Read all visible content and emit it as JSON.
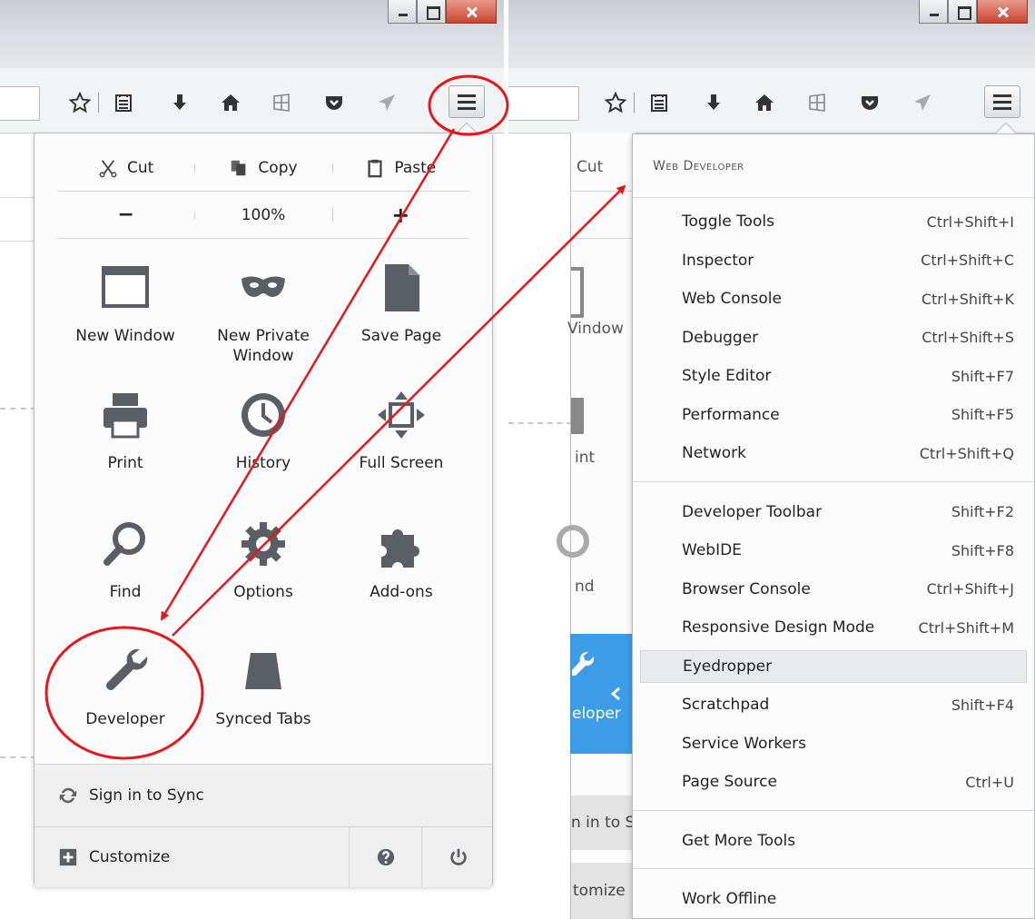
{
  "left_panel": {
    "edit": {
      "cut": "Cut",
      "copy": "Copy",
      "paste": "Paste"
    },
    "zoom": {
      "minus": "−",
      "level": "100%",
      "plus": "+"
    },
    "items": [
      {
        "label": "New Window",
        "icon": "window-icon"
      },
      {
        "label": "New Private\nWindow",
        "icon": "mask-icon"
      },
      {
        "label": "Save Page",
        "icon": "page-icon"
      },
      {
        "label": "Print",
        "icon": "printer-icon"
      },
      {
        "label": "History",
        "icon": "clock-icon"
      },
      {
        "label": "Full Screen",
        "icon": "fullscreen-icon"
      },
      {
        "label": "Find",
        "icon": "magnifier-icon"
      },
      {
        "label": "Options",
        "icon": "gear-icon"
      },
      {
        "label": "Add-ons",
        "icon": "puzzle-icon"
      },
      {
        "label": "Developer",
        "icon": "wrench-icon"
      },
      {
        "label": "Synced Tabs",
        "icon": "synced-tabs-icon"
      }
    ],
    "sign_in": "Sign in to Sync",
    "customize": "Customize"
  },
  "right_bg": {
    "cut": "Cut",
    "window": "Vindow",
    "print": "int",
    "find": "nd",
    "developer": "eloper",
    "sync": "n in to S",
    "customize": "tomize"
  },
  "dev_menu": {
    "header": "Web Developer",
    "groups": [
      [
        {
          "label": "Toggle Tools",
          "key": "Ctrl+Shift+I"
        },
        {
          "label": "Inspector",
          "key": "Ctrl+Shift+C"
        },
        {
          "label": "Web Console",
          "key": "Ctrl+Shift+K"
        },
        {
          "label": "Debugger",
          "key": "Ctrl+Shift+S"
        },
        {
          "label": "Style Editor",
          "key": "Shift+F7"
        },
        {
          "label": "Performance",
          "key": "Shift+F5"
        },
        {
          "label": "Network",
          "key": "Ctrl+Shift+Q"
        }
      ],
      [
        {
          "label": "Developer Toolbar",
          "key": "Shift+F2"
        },
        {
          "label": "WebIDE",
          "key": "Shift+F8"
        },
        {
          "label": "Browser Console",
          "key": "Ctrl+Shift+J"
        },
        {
          "label": "Responsive Design Mode",
          "key": "Ctrl+Shift+M"
        },
        {
          "label": "Eyedropper",
          "key": ""
        },
        {
          "label": "Scratchpad",
          "key": "Shift+F4"
        },
        {
          "label": "Service Workers",
          "key": ""
        },
        {
          "label": "Page Source",
          "key": "Ctrl+U"
        }
      ],
      [
        {
          "label": "Get More Tools",
          "key": ""
        }
      ],
      [
        {
          "label": "Work Offline",
          "key": ""
        }
      ]
    ],
    "highlighted": "Eyedropper"
  },
  "colors": {
    "annotation": "#e8161b",
    "accent": "#3d9ce8",
    "icon": "#555a60"
  }
}
